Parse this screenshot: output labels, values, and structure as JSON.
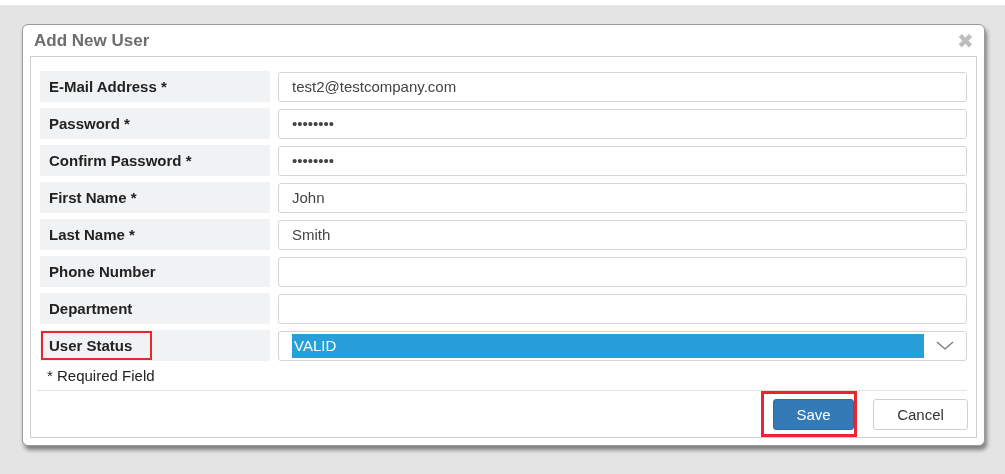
{
  "dialog": {
    "title": "Add New User",
    "close": "✖"
  },
  "fields": [
    {
      "kind": "text",
      "label": "E-Mail Address *",
      "value": "test2@testcompany.com",
      "highlighted": false
    },
    {
      "kind": "text",
      "label": "Password *",
      "value": "••••••••",
      "highlighted": false
    },
    {
      "kind": "text",
      "label": "Confirm Password *",
      "value": "••••••••",
      "highlighted": false
    },
    {
      "kind": "text",
      "label": "First Name *",
      "value": "John",
      "highlighted": false
    },
    {
      "kind": "text",
      "label": "Last Name *",
      "value": "Smith",
      "highlighted": false
    },
    {
      "kind": "text",
      "label": "Phone Number",
      "highlighted": false
    },
    {
      "kind": "text",
      "label": "Department",
      "highlighted": false
    },
    {
      "kind": "select",
      "label": "User Status",
      "value": "VALID",
      "value_selected": true,
      "highlighted": true
    }
  ],
  "note": "* Required Field",
  "buttons": [
    {
      "label": "Save",
      "primary": true,
      "highlighted": true
    },
    {
      "label": "Cancel",
      "primary": false,
      "highlighted": false
    }
  ]
}
